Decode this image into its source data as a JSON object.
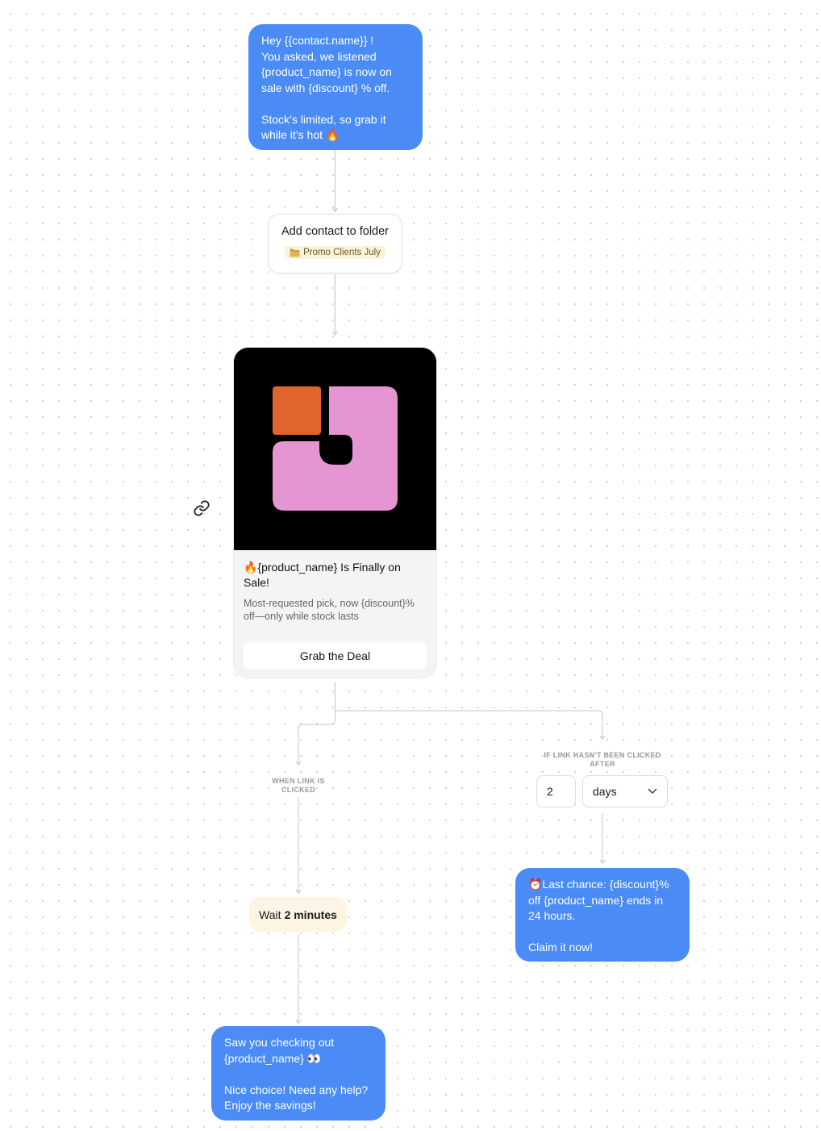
{
  "messages": {
    "intro": "Hey {{contact.name}} !\nYou asked, we listened\n{product_name} is now  on sale with {discount} % off.\n\nStock’s limited, so grab it while it’s hot 🔥",
    "clicked_followup": "Saw you checking out {product_name} 👀\n\nNice choice! Need any help? Enjoy the savings!",
    "last_chance": "⏰Last chance: {discount}% off {product_name} ends in 24 hours.\n\nClaim it now!"
  },
  "folder_action": {
    "title": "Add contact to folder",
    "folder_name": "Promo Clients July",
    "icon": "folder-icon"
  },
  "promo_card": {
    "title": "🔥{product_name} Is Finally on Sale!",
    "description": "Most-requested pick, now {discount}% off—only while stock lasts",
    "button_label": "Grab the Deal",
    "image_colors": {
      "background": "#000000",
      "orange": "#e0642d",
      "pink": "#e596d2"
    }
  },
  "branches": {
    "clicked_label": "WHEN LINK IS CLICKED",
    "not_clicked_label": "IF LINK HASN'T BEEN CLICKED AFTER",
    "delay_value": "2",
    "delay_unit": "days"
  },
  "wait": {
    "prefix": "Wait",
    "duration": "2 minutes"
  },
  "colors": {
    "bubble": "#4a8bf5",
    "connector": "#c4c4c4",
    "wait_bg": "#fdf5e2",
    "folder_tag_bg": "#fbf4dc"
  }
}
